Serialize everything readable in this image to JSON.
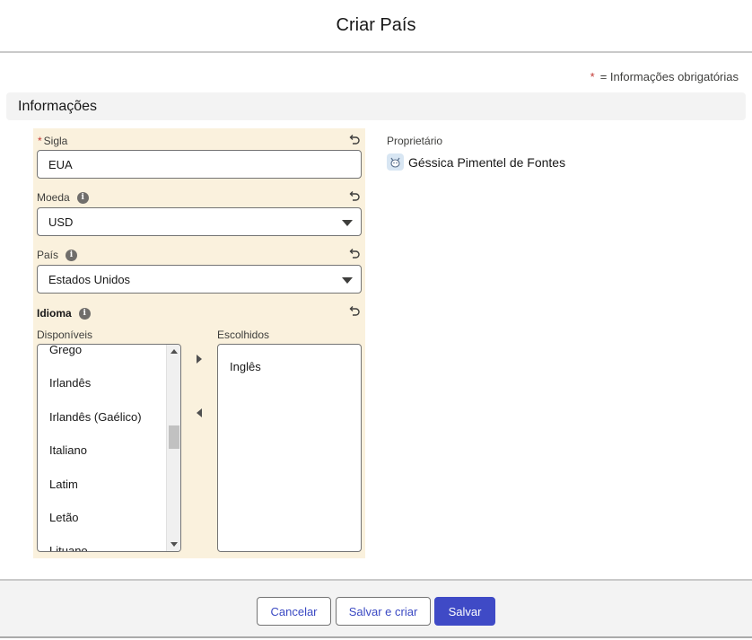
{
  "modal": {
    "title": "Criar País"
  },
  "required_note": {
    "star": "*",
    "text": "= Informações obrigatórias"
  },
  "section": {
    "title": "Informações"
  },
  "fields": {
    "sigla": {
      "required_mark": "*",
      "label": "Sigla",
      "value": "EUA"
    },
    "moeda": {
      "label": "Moeda",
      "info_icon": "i",
      "value": "USD"
    },
    "pais": {
      "label": "País",
      "info_icon": "i",
      "value": "Estados Unidos"
    },
    "idioma": {
      "label": "Idioma",
      "info_icon": "i",
      "available_label": "Disponíveis",
      "chosen_label": "Escolhidos",
      "available": [
        "Grego",
        "Irlandês",
        "Irlandês (Gaélico)",
        "Italiano",
        "Latim",
        "Letão",
        "Lituano"
      ],
      "chosen": [
        "Inglês"
      ]
    }
  },
  "owner": {
    "label": "Proprietário",
    "name": "Géssica Pimentel de Fontes"
  },
  "footer": {
    "cancel": "Cancelar",
    "save_new": "Salvar e criar",
    "save": "Salvar"
  },
  "colors": {
    "edited_bg": "#faf1dd",
    "brand": "#3f4ac6",
    "required": "#c23934"
  },
  "icons": [
    "undo-icon",
    "info-icon",
    "chevron-down-icon",
    "arrow-right-icon",
    "arrow-left-icon",
    "avatar-icon"
  ]
}
